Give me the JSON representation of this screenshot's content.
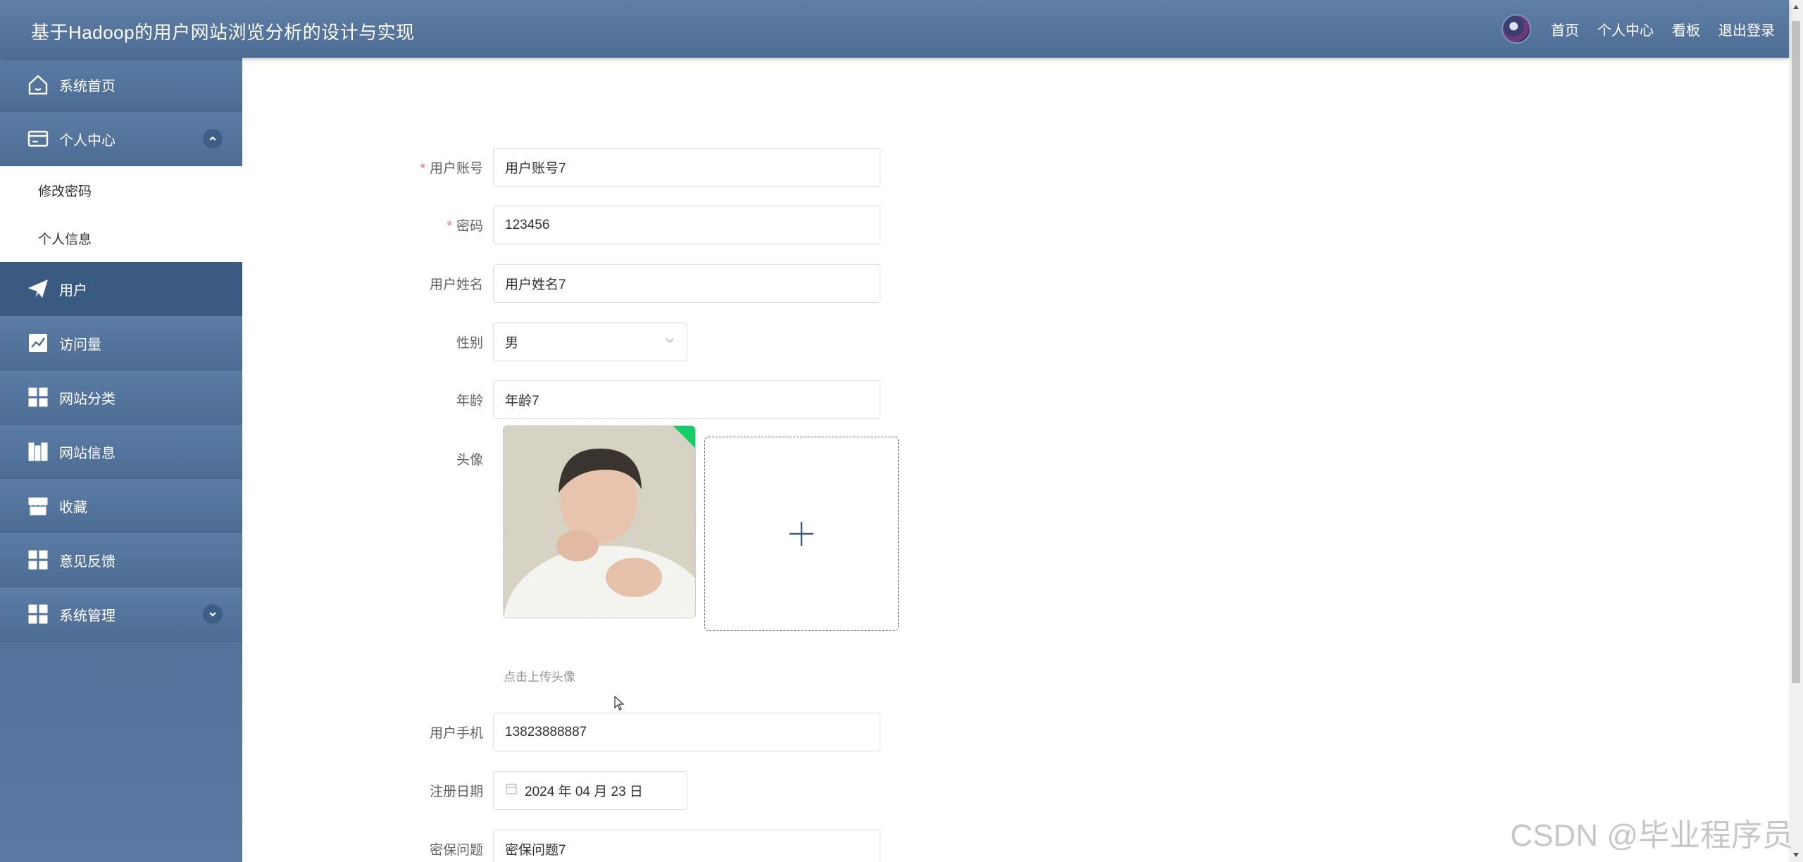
{
  "header": {
    "title": "基于Hadoop的用户网站浏览分析的设计与实现",
    "nav": [
      "首页",
      "个人中心",
      "看板",
      "退出登录"
    ]
  },
  "sidebar": {
    "items": [
      {
        "label": "系统首页",
        "icon": "home-icon"
      },
      {
        "label": "个人中心",
        "icon": "card-icon",
        "expanded": true,
        "children": [
          "修改密码",
          "个人信息"
        ]
      },
      {
        "label": "用户",
        "icon": "paper-plane-icon",
        "active": true
      },
      {
        "label": "访问量",
        "icon": "chart-line-icon"
      },
      {
        "label": "网站分类",
        "icon": "grid-icon"
      },
      {
        "label": "网站信息",
        "icon": "books-icon"
      },
      {
        "label": "收藏",
        "icon": "store-icon"
      },
      {
        "label": "意见反馈",
        "icon": "grid-icon"
      },
      {
        "label": "系统管理",
        "icon": "grid-icon",
        "expanded": false
      }
    ]
  },
  "form": {
    "account": {
      "label": "用户账号",
      "value": "用户账号7",
      "required": true
    },
    "password": {
      "label": "密码",
      "value": "123456",
      "required": true
    },
    "name": {
      "label": "用户姓名",
      "value": "用户姓名7"
    },
    "gender": {
      "label": "性别",
      "value": "男"
    },
    "age": {
      "label": "年龄",
      "value": "年龄7"
    },
    "avatar": {
      "label": "头像",
      "tip": "点击上传头像"
    },
    "phone": {
      "label": "用户手机",
      "value": "13823888887"
    },
    "register_date": {
      "label": "注册日期",
      "value": "2024 年 04 月 23 日"
    },
    "security_question": {
      "label": "密保问题",
      "value": "密保问题7"
    }
  },
  "watermark": "CSDN @毕业程序员",
  "colors": {
    "header": "#5a7aa3",
    "sidebar": "#4f6f98",
    "active_menu": "#3b5a82",
    "required": "#f56c6c"
  }
}
